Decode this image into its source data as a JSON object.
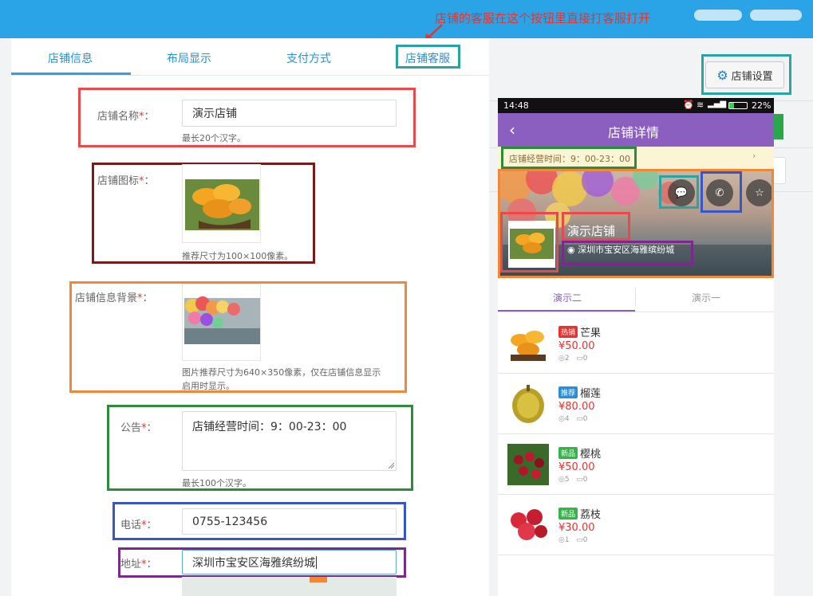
{
  "banner": {
    "annotation": "店铺的客服在这个按钮里直接打客服打开"
  },
  "background": {
    "settings_button": "店铺设置"
  },
  "tabs": [
    "店铺信息",
    "布局显示",
    "支付方式",
    "店铺客服"
  ],
  "form": {
    "name": {
      "label": "店铺名称",
      "value": "演示店铺",
      "hint": "最长20个汉字。"
    },
    "icon": {
      "label": "店铺图标",
      "hint": "推荐尺寸为100×100像素。"
    },
    "background": {
      "label": "店铺信息背景",
      "hint_line1": "图片推荐尺寸为640×350像素，仅在店铺信息显示",
      "hint_line2": "启用时显示。"
    },
    "notice": {
      "label": "公告",
      "value": "店铺经营时间：9：00-23：00",
      "hint": "最长100个汉字。"
    },
    "phone": {
      "label": "电话",
      "value": "0755-123456"
    },
    "address": {
      "label": "地址",
      "value": "深圳市宝安区海雅缤纷城"
    },
    "required_mark": "*",
    "colon": "："
  },
  "phone": {
    "time": "14:48",
    "battery": "22%",
    "title": "店铺详情",
    "notice": "店铺经营时间：9：00-23：00",
    "shop_name": "演示店铺",
    "address": "深圳市宝安区海雅缤纷城",
    "tabs": [
      "演示二",
      "演示一"
    ],
    "products": [
      {
        "tag": "热销",
        "tag_color": "#e8332f",
        "name": "芒果",
        "price": "¥50.00",
        "likes": "2",
        "comments": "0",
        "img": "mango"
      },
      {
        "tag": "推荐",
        "tag_color": "#2a8fd8",
        "name": "榴莲",
        "price": "¥80.00",
        "likes": "4",
        "comments": "0",
        "img": "durian"
      },
      {
        "tag": "新品",
        "tag_color": "#37b34a",
        "name": "樱桃",
        "price": "¥50.00",
        "likes": "5",
        "comments": "0",
        "img": "cherry"
      },
      {
        "tag": "新品",
        "tag_color": "#37b34a",
        "name": "荔枝",
        "price": "¥30.00",
        "likes": "1",
        "comments": "0",
        "img": "lychee"
      }
    ]
  },
  "colors": {
    "banner": "#2aa4e6",
    "annotation_red": "#e8332f",
    "app_purple": "#8a5fc0",
    "price_red": "#e8332f"
  }
}
